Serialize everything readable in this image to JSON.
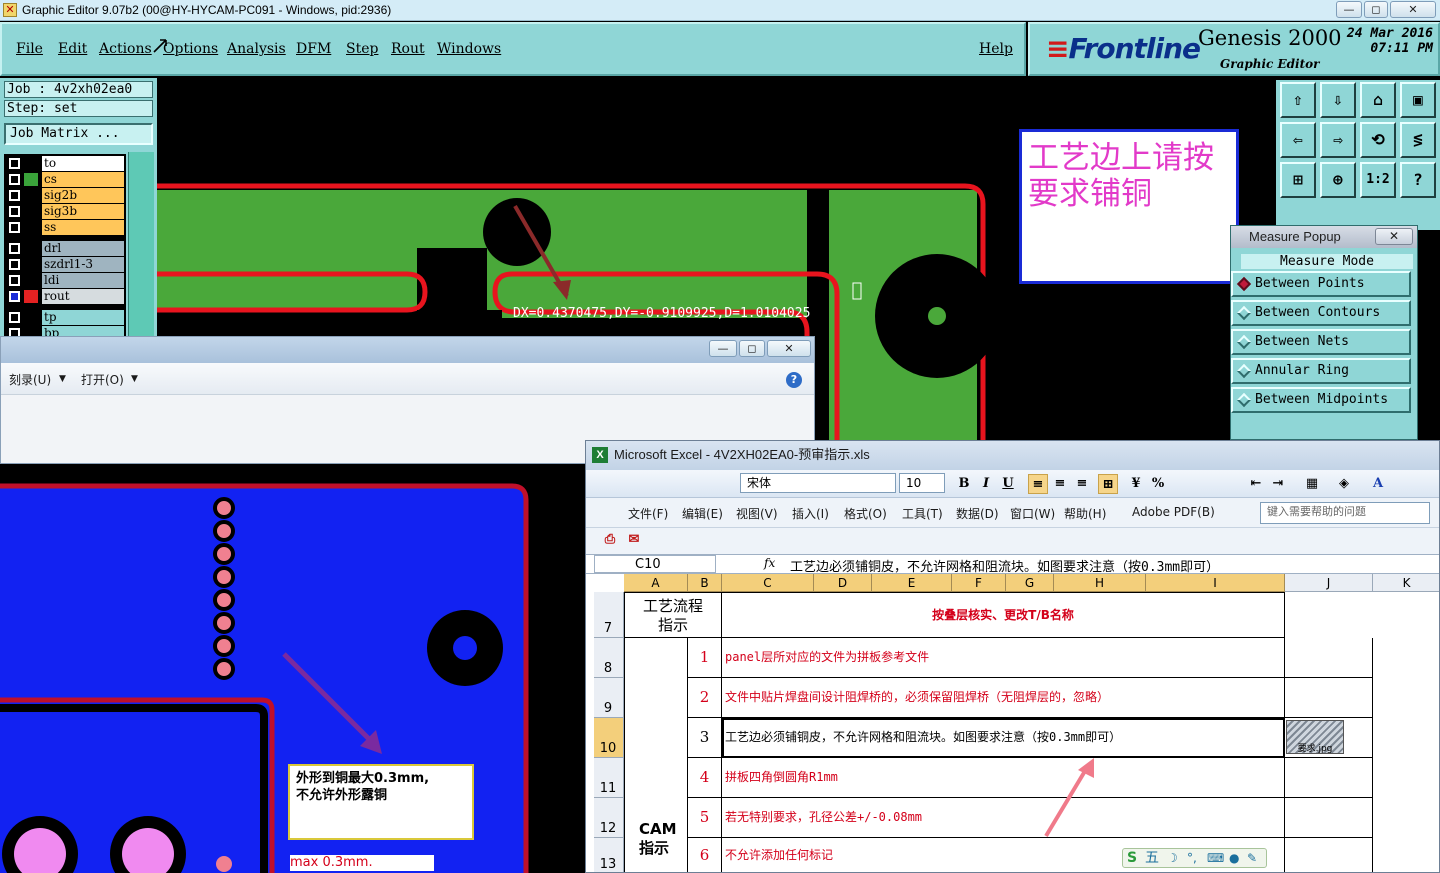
{
  "window": {
    "title": "Graphic Editor 9.07b2 (00@HY-HYCAM-PC091 - Windows, pid:2936)",
    "min": "—",
    "max": "◻",
    "close": "✕"
  },
  "menubar": {
    "items": [
      "File",
      "Edit",
      "Actions",
      "Options",
      "Analysis",
      "DFM",
      "Step",
      "Rout",
      "Windows"
    ],
    "help": "Help"
  },
  "brand": {
    "logo": "Frontline",
    "product": "Genesis 2000",
    "subtitle": "Graphic Editor",
    "date": "24 Mar 2016",
    "time": "07:11 PM"
  },
  "job": {
    "job_line": "Job  : 4v2xh02ea0",
    "step_line": "Step: set",
    "job_matrix": "Job Matrix ..."
  },
  "layers": [
    {
      "name": "to",
      "color": "#ffffff",
      "swatch": "#000000",
      "active": false
    },
    {
      "name": "cs",
      "color": "#ffc65a",
      "swatch": "#3aa33a",
      "active": false
    },
    {
      "name": "sig2b",
      "color": "#ffc65a",
      "swatch": "#000000",
      "active": false
    },
    {
      "name": "sig3b",
      "color": "#ffc65a",
      "swatch": "#000000",
      "active": false
    },
    {
      "name": "ss",
      "color": "#ffc65a",
      "swatch": "#000000",
      "active": false
    },
    {
      "name": "drl",
      "color": "#9fb4c0",
      "swatch": "#000000",
      "active": false
    },
    {
      "name": "szdrl1-3",
      "color": "#9fb4c0",
      "swatch": "#000000",
      "active": false
    },
    {
      "name": "ldi",
      "color": "#9fb4c0",
      "swatch": "#000000",
      "active": false
    },
    {
      "name": "rout",
      "color": "#d6dcdf",
      "swatch": "#e32222",
      "active": true
    },
    {
      "name": "tp",
      "color": "#8fd6d6",
      "swatch": "#000000",
      "active": false
    },
    {
      "name": "bp",
      "color": "#8fd6d6",
      "swatch": "#000000",
      "active": false
    }
  ],
  "canvas": {
    "measure_readout": "DX=0.4370475,DY=-0.9109925,D=1.0104025"
  },
  "note": {
    "text": "工艺边上请按要求铺铜"
  },
  "toolbar": {
    "buttons": [
      "⇧",
      "⇩",
      "⌂",
      "▣",
      "⇦",
      "⇨",
      "⟲",
      "≶",
      "⊞",
      "⊕",
      "1:2",
      "?"
    ]
  },
  "measure_popup": {
    "title": "Measure Popup",
    "close": "✕",
    "mode_label": "Measure Mode",
    "options": [
      "Between Points",
      "Between Contours",
      "Between Nets",
      "Annular Ring",
      "Between Midpoints"
    ],
    "selected": 0
  },
  "folder_window": {
    "commands": [
      "刻录(U)",
      "打开(O)"
    ],
    "help": "?"
  },
  "pcb_bottom": {
    "callout": "外形到铜最大0.3mm,\n不允许外形露铜",
    "max_label": "max 0.3mm."
  },
  "excel": {
    "title": "Microsoft Excel - 4V2XH02EA0-预审指示.xls",
    "font_name": "宋体",
    "font_size": "10",
    "format_buttons": [
      "B",
      "I",
      "U"
    ],
    "menu": [
      "文件(F)",
      "编辑(E)",
      "视图(V)",
      "插入(I)",
      "格式(O)",
      "工具(T)",
      "数据(D)",
      "窗口(W)",
      "帮助(H)",
      "Adobe PDF(B)"
    ],
    "help_box": "键入需要帮助的问题",
    "name_box": "C10",
    "fx": "fx",
    "formula": "工艺边必须铺铜皮，不允许网格和阻流块。如图要求注意（按0.3mm即可）",
    "columns": [
      "A",
      "B",
      "C",
      "D",
      "E",
      "F",
      "G",
      "H",
      "I",
      "J",
      "K"
    ],
    "row_numbers": [
      "7",
      "8",
      "9",
      "10",
      "11",
      "12",
      "13"
    ],
    "header_a": "工艺流程指示",
    "header_c": "按叠层核实、更改T/B名称",
    "group_label": "CAM\n指示",
    "rows": [
      {
        "num": "1",
        "text": "panel层所对应的文件为拼板参考文件"
      },
      {
        "num": "2",
        "text": "文件中贴片焊盘间设计阻焊桥的，必须保留阻焊桥（无阻焊层的，忽略）"
      },
      {
        "num": "3",
        "text": "工艺边必须铺铜皮，不允许网格和阻流块。如图要求注意（按0.3mm即可）"
      },
      {
        "num": "4",
        "text": "拼板四角倒圆角R1mm"
      },
      {
        "num": "5",
        "text": "若无特别要求，孔径公差+/-0.08mm"
      },
      {
        "num": "6",
        "text": "不允许添加任何标记"
      }
    ],
    "thumb_label": "要求.jpg"
  },
  "ime": {
    "label": "五"
  }
}
